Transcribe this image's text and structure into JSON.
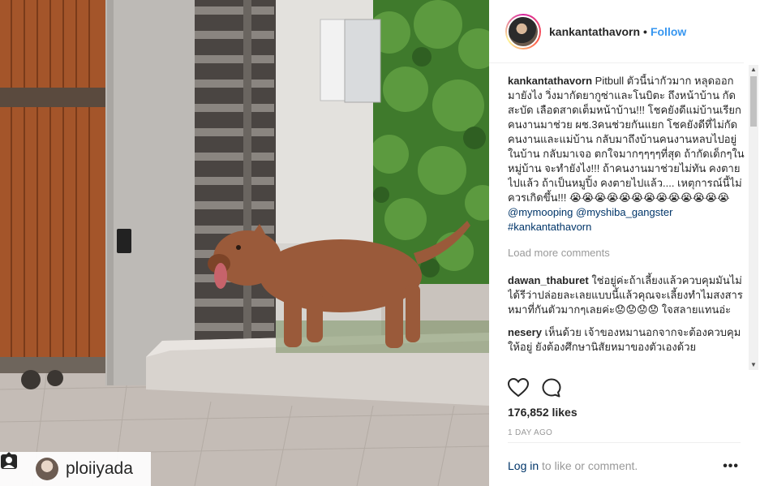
{
  "photo": {
    "tag": {
      "username": "ploiiyada"
    }
  },
  "header": {
    "username": "kankantathavorn",
    "separator": "•",
    "follow_label": "Follow"
  },
  "caption": {
    "username": "kankantathavorn",
    "text": "Pitbull ตัวนี้น่ากัวมาก หลุดออกมายังไง วิ่งมากัดยากูซ่าและโนบิตะ ถึงหน้าบ้าน กัดสะบัด เลือดสาดเต็มหน้าบ้าน!!! โชคยังดีแม่บ้านเรียกคนงานมาช่วย ผช.3คนช่วยกันแยก โชคยังดีที่ไม่กัดคนงานและแม่บ้าน กลับมาถึงบ้านคนงานหลบไปอยู่ในบ้าน กลับมาเจอ ตกใจมากๆๆๆๆที่สุด ถ้ากัดเด็กๆในหมู่บ้าน จะทำยังไง!!! ถ้าคนงานมาช่วยไม่ทัน คงตายไปแล้ว ถ้าเป็นหมูปิ้ง คงตายไปแล้ว.... เหตุการณ์นี้ไม่ควรเกิดขึ้น!!! 😭😭😭😭😭😭😭😭😭😭😭😭😭",
    "mention_line": "@mymooping @myshiba_gangster",
    "hashtag": "#kankantathavorn"
  },
  "load_more_label": "Load more comments",
  "comments": [
    {
      "username": "dawan_thaburet",
      "text": "ใช่อยู่ค่ะถ้าเลี้ยงแล้วควบคุมมันไม่ได้รีว่าปล่อยละเลยแบบนี้แล้วคุณจะเลี้ยงทำไมสงสารหมาที่กันตัวมากๆเลยค่ะ😟😟😟😟 ใจสลายแทนอ่ะ"
    },
    {
      "username": "nesery",
      "text": "เห็นด้วย เจ้าของหมานอกจากจะต้องควบคุมให้อยู่ ยังต้องศึกษานิสัยหมาของตัวเองด้วย"
    }
  ],
  "likes": "176,852 likes",
  "timestamp": "1 DAY AGO",
  "footer": {
    "login_label": "Log in",
    "rest": " to like or comment.",
    "more_label": "•••"
  },
  "icons": {
    "like": "heart-icon",
    "comment": "comment-bubble-icon",
    "tag": "user-tag-icon"
  }
}
